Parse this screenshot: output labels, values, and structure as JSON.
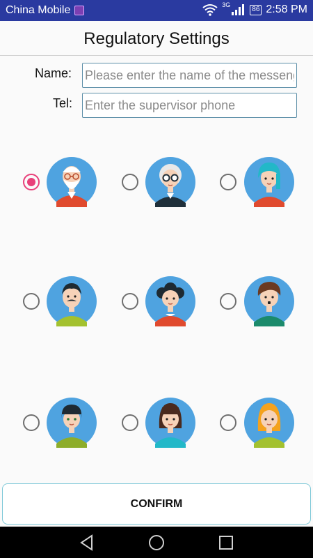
{
  "status_bar": {
    "carrier": "China Mobile",
    "network": "3G",
    "battery": "86",
    "time": "2:58 PM"
  },
  "header": {
    "title": "Regulatory Settings"
  },
  "form": {
    "name_label": "Name:",
    "name_placeholder": "Please enter the name of the messenger",
    "tel_label": "Tel:",
    "tel_placeholder": "Enter the supervisor phone"
  },
  "avatars": [
    {
      "icon": "old-man-beard-avatar-icon",
      "selected": true
    },
    {
      "icon": "old-woman-glasses-avatar-icon",
      "selected": false
    },
    {
      "icon": "girl-teal-hair-avatar-icon",
      "selected": false
    },
    {
      "icon": "man-mustache-avatar-icon",
      "selected": false
    },
    {
      "icon": "woman-curly-hair-avatar-icon",
      "selected": false
    },
    {
      "icon": "boy-brown-hair-avatar-icon",
      "selected": false
    },
    {
      "icon": "boy-bowl-cut-avatar-icon",
      "selected": false
    },
    {
      "icon": "girl-brown-bob-avatar-icon",
      "selected": false
    },
    {
      "icon": "girl-blonde-hair-avatar-icon",
      "selected": false
    }
  ],
  "confirm_label": "CONFIRM",
  "colors": {
    "status_bar": "#2a3aa0",
    "radio_selected": "#e8407a",
    "input_border": "#5d8fa8",
    "avatar_bg": "#4fa3e0"
  }
}
